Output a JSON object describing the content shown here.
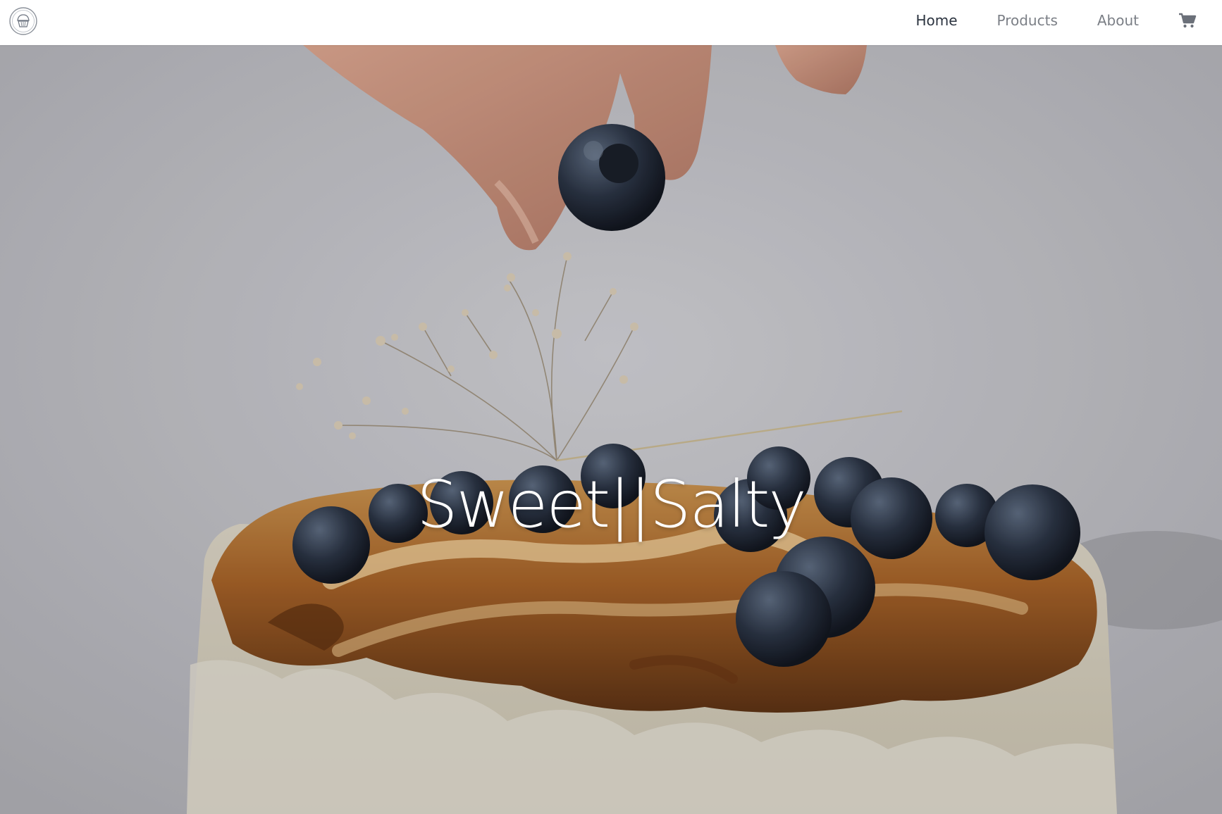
{
  "nav": {
    "logo_icon": "cupcake-logo-icon",
    "links": [
      {
        "label": "Home",
        "active": true
      },
      {
        "label": "Products",
        "active": false
      },
      {
        "label": "About",
        "active": false
      }
    ],
    "cart_icon": "shopping-cart-icon"
  },
  "hero": {
    "title": "Sweet||Salty",
    "image": "cake-with-blueberries-photo"
  },
  "colors": {
    "nav_active": "#2c3440",
    "nav_inactive": "#7b7f86",
    "hero_text": "#ffffff",
    "background": "#ffffff"
  }
}
